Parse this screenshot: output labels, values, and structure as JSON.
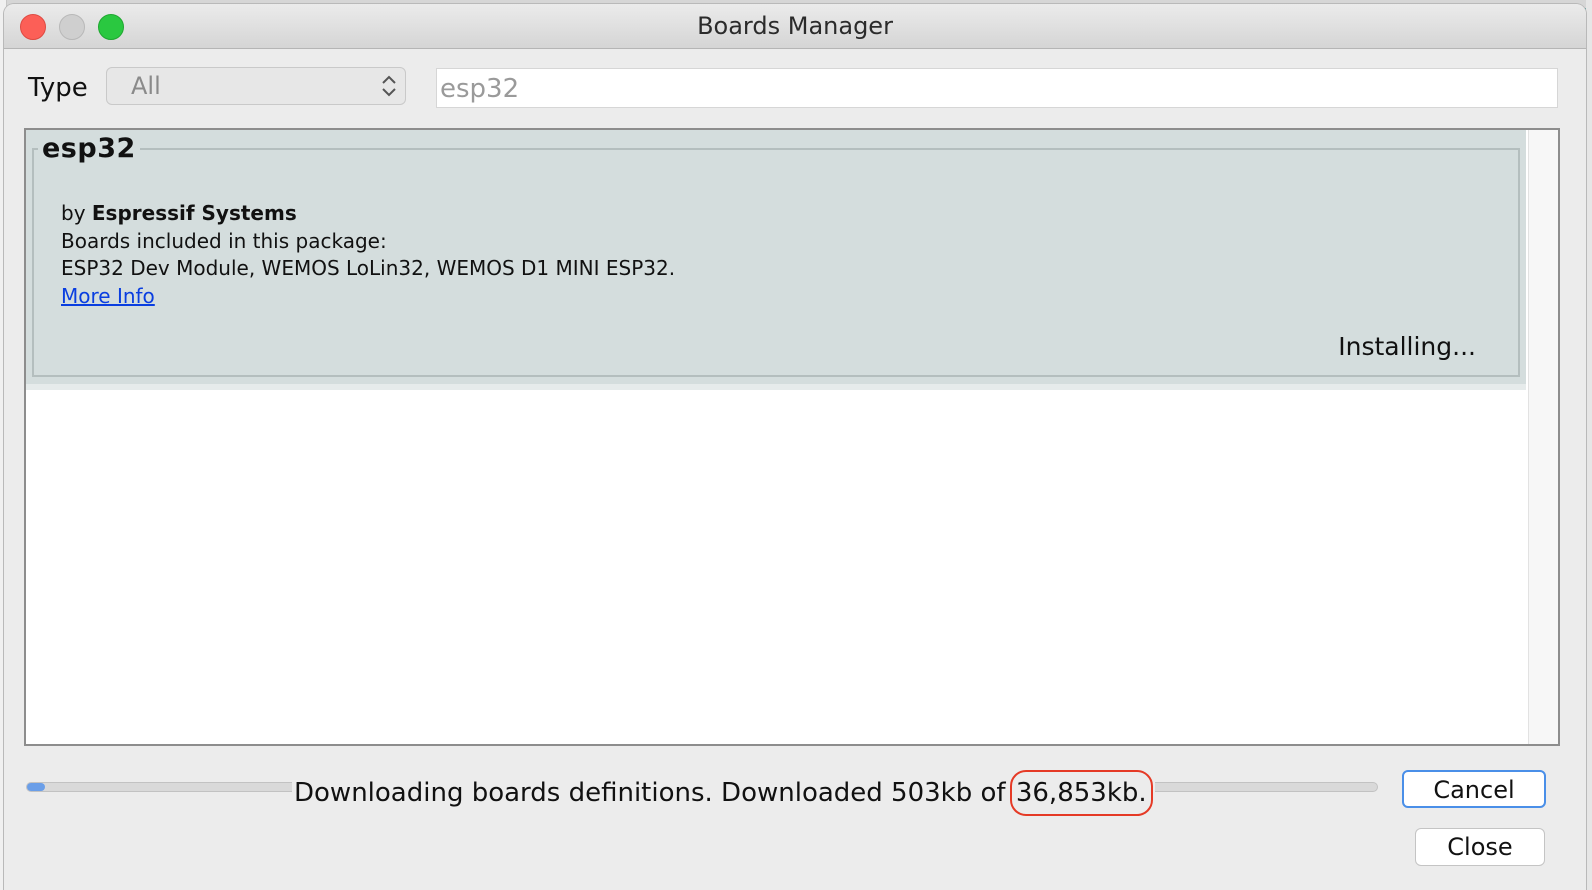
{
  "window": {
    "title": "Boards Manager"
  },
  "filter": {
    "type_label": "Type",
    "type_value": "All",
    "search_value": "esp32"
  },
  "package": {
    "name": "esp32",
    "author_prefix": "by",
    "author": "Espressif Systems",
    "boards_heading": "Boards included in this package:",
    "boards": "ESP32 Dev Module, WEMOS LoLin32, WEMOS D1 MINI ESP32.",
    "more_info": "More Info",
    "status": "Installing..."
  },
  "footer": {
    "status_text": "Downloading boards definitions. Downloaded 503kb of",
    "total_size": "36,853kb.",
    "progress_fraction": 0.0136,
    "cancel_label": "Cancel",
    "close_label": "Close"
  },
  "colors": {
    "accent": "#4a8fe8",
    "highlight_circle": "#e53a26",
    "link": "#0a3ee0",
    "item_background": "#d4dddd"
  }
}
